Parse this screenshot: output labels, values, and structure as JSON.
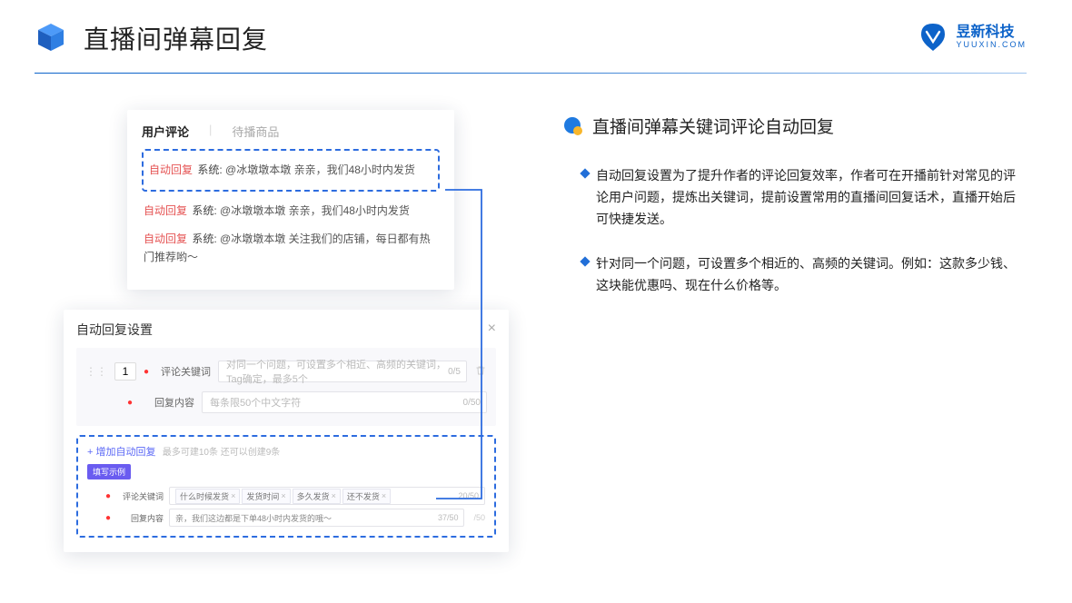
{
  "header": {
    "title": "直播间弹幕回复",
    "brand_cn": "昱新科技",
    "brand_en": "YUUXIN.COM"
  },
  "comments_card": {
    "tab_active": "用户评论",
    "tab_other": "待播商品",
    "highlight": {
      "tag": "自动回复",
      "sys": "系统:",
      "body": "@冰墩墩本墩 亲亲，我们48小时内发货"
    },
    "rows": [
      {
        "tag": "自动回复",
        "sys": "系统:",
        "body": "@冰墩墩本墩 亲亲，我们48小时内发货"
      },
      {
        "tag": "自动回复",
        "sys": "系统:",
        "body": "@冰墩墩本墩 关注我们的店铺，每日都有热门推荐哟～"
      }
    ]
  },
  "settings_card": {
    "title": "自动回复设置",
    "index": "1",
    "labels": {
      "keyword": "评论关键词",
      "reply": "回复内容"
    },
    "placeholders": {
      "keyword": "对同一个问题，可设置多个相近、高频的关键词，Tag确定，最多5个",
      "reply": "每条限50个中文字符"
    },
    "counters": {
      "keyword": "0/5",
      "reply": "0/50"
    },
    "add_link": "+ 增加自动回复",
    "add_sub": "最多可建10条 还可以创建9条",
    "example_badge": "填写示例",
    "example": {
      "chips": [
        "什么时候发货",
        "发货时间",
        "多久发货",
        "还不发货"
      ],
      "chip_counter": "20/50",
      "reply_text": "亲，我们这边都是下单48小时内发货的哦～",
      "reply_counter": "37/50",
      "outer_counter": "/50"
    }
  },
  "right": {
    "section_title": "直播间弹幕关键词评论自动回复",
    "bullets": [
      "自动回复设置为了提升作者的评论回复效率，作者可在开播前针对常见的评论用户问题，提炼出关键词，提前设置常用的直播间回复话术，直播开始后可快捷发送。",
      "针对同一个问题，可设置多个相近的、高频的关键词。例如：这款多少钱、这块能优惠吗、现在什么价格等。"
    ]
  }
}
